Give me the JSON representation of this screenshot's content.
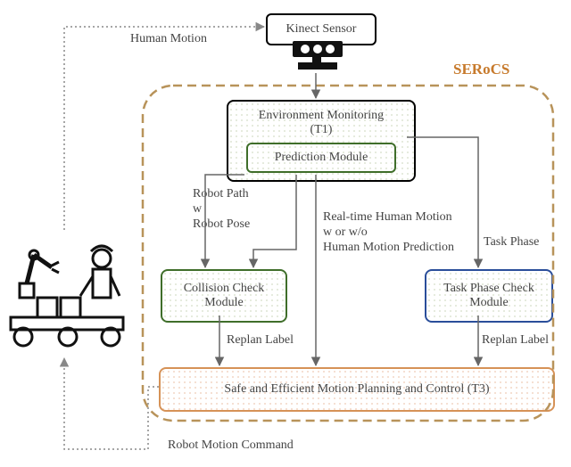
{
  "title": "SERoCS",
  "sensor": {
    "label": "Kinect Sensor"
  },
  "env": {
    "title": "Environment Monitoring\n(T1)",
    "sub": "Prediction Module"
  },
  "collision": {
    "title": "Collision Check\nModule"
  },
  "phasecheck": {
    "title": "Task Phase Check\nModule"
  },
  "planning": {
    "title": "Safe and Efficient Motion Planning and Control (T3)"
  },
  "edges": {
    "hm": "Human Motion",
    "robotpath": "Robot Path\nw\nRobot Pose",
    "rt": "Real-time Human Motion\nw or w/o\nHuman Motion Prediction",
    "tp": "Task Phase",
    "replan1": "Replan Label",
    "replan2": "Replan Label",
    "cmd": "Robot Motion Command"
  }
}
